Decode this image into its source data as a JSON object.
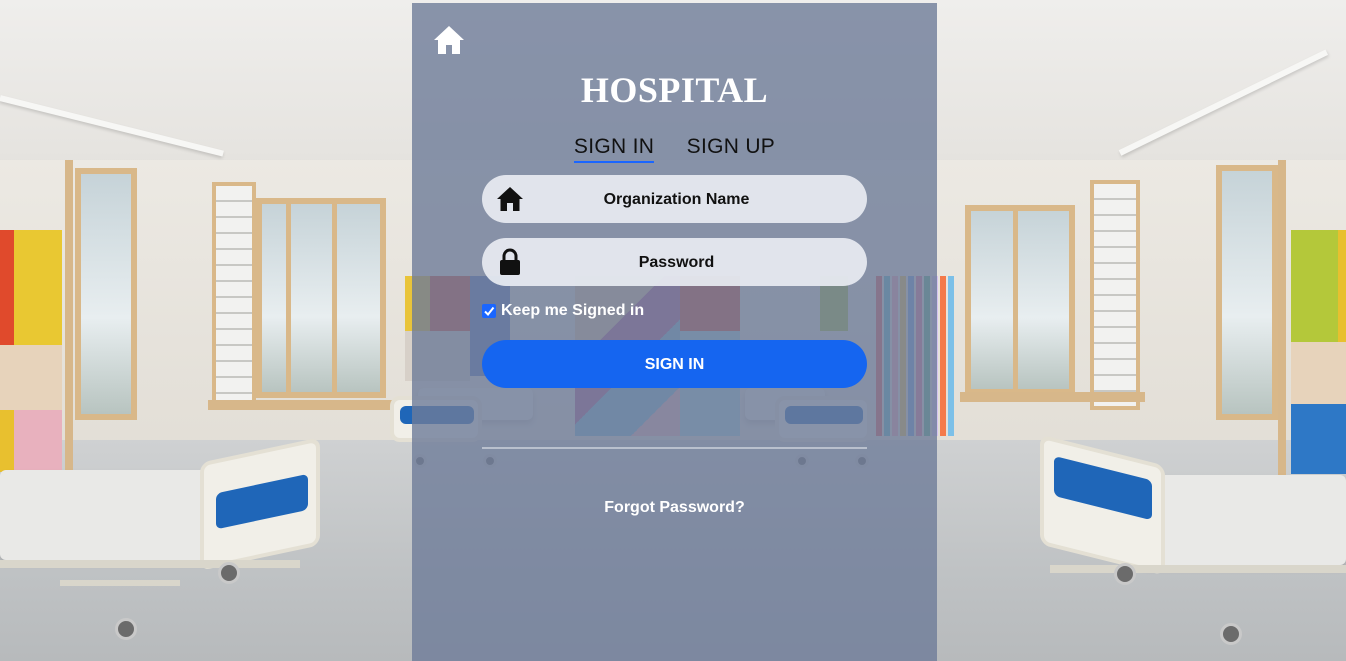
{
  "brand": {
    "title": "HOSPITAL"
  },
  "tabs": [
    {
      "label": "SIGN IN",
      "active": true
    },
    {
      "label": "SIGN UP",
      "active": false
    }
  ],
  "form": {
    "organization": {
      "placeholder": "Organization Name",
      "value": "",
      "icon": "home-icon"
    },
    "password": {
      "placeholder": "Password",
      "value": "",
      "icon": "lock-icon"
    },
    "keep_signed_in": {
      "label": "Keep me Signed in",
      "checked": true
    },
    "submit_label": "SIGN IN",
    "forgot_label": "Forgot Password?"
  },
  "nav": {
    "home_icon": "home-icon"
  },
  "colors": {
    "accent": "#1565f0",
    "panel_overlay": "#6e7c98",
    "field_bg": "#e8ebf2",
    "text_light": "#ffffff"
  }
}
